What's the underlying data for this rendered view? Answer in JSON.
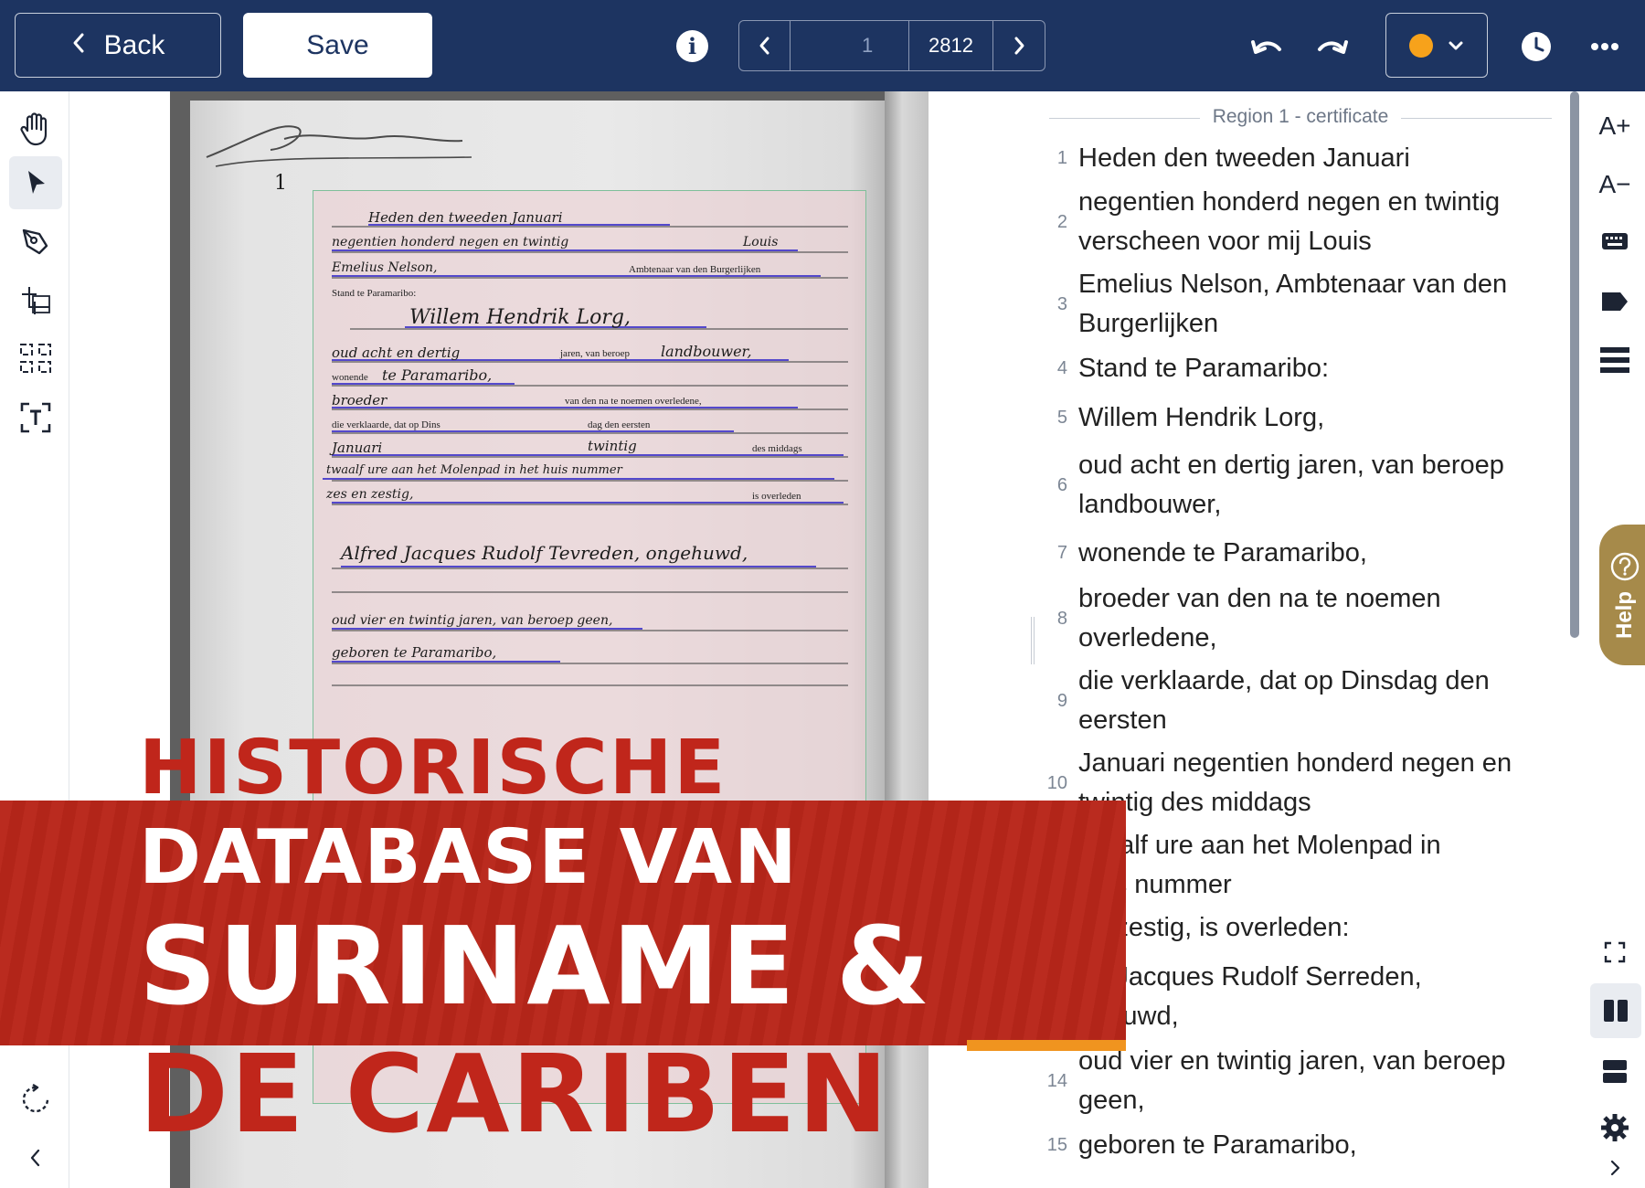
{
  "toolbar": {
    "back_label": "Back",
    "save_label": "Save",
    "info_label": "i",
    "pager": {
      "current_placeholder": "1",
      "total": "2812"
    },
    "status_color": "#f7a21b"
  },
  "left_tools": [
    "hand-icon",
    "pointer-icon",
    "pen-icon",
    "add-line-icon",
    "split-region-icon",
    "text-detect-icon",
    "rotate-icon",
    "collapse-left-icon"
  ],
  "transcript": {
    "region_title": "Region 1 - certificate",
    "lines": [
      {
        "num": "1",
        "text": "Heden den tweeden Januari"
      },
      {
        "num": "2",
        "text": "negentien honderd negen en twintig\nverscheen voor mij Louis"
      },
      {
        "num": "3",
        "text": "Emelius Nelson, Ambtenaar van den\nBurgerlijken"
      },
      {
        "num": "4",
        "text": "Stand te Paramaribo:"
      },
      {
        "num": "5",
        "text": "Willem Hendrik Lorg,"
      },
      {
        "num": "6",
        "text": "oud acht en dertig jaren, van beroep\nlandbouwer,"
      },
      {
        "num": "7",
        "text": "wonende te Paramaribo,"
      },
      {
        "num": "8",
        "text": "broeder van den na te noemen\noverledene,"
      },
      {
        "num": "9",
        "text": "die verklaarde, dat op Dinsdag den\neersten"
      },
      {
        "num": "10",
        "text": "Januari negentien honderd negen en\ntwintig des middags"
      },
      {
        "num": "",
        "text": "twaalf ure aan het Molenpad in\nhuis nummer"
      },
      {
        "num": "",
        "text": "en zestig, is overleden:"
      },
      {
        "num": "",
        "text": "ed Jacques Rudolf Serreden,\ngehuwd,"
      },
      {
        "num": "14",
        "text": "oud vier en twintig jaren, van beroep\ngeen,"
      },
      {
        "num": "15",
        "text": "geboren te Paramaribo,"
      }
    ]
  },
  "right_tools": {
    "font_increase": "A+",
    "font_decrease": "A−"
  },
  "help_label": "Help",
  "document": {
    "handwriting": [
      "Heden den tweeden Januari",
      "negentien honderd negen en twintig",
      "Louis",
      "Emelius Nelson,",
      "Ambtenaar van den Burgerlijken",
      "Stand te Paramaribo:",
      "Willem Hendrik Lorg,",
      "oud acht en dertig",
      "jaren, van beroep",
      "landbouwer,",
      "wonende",
      "te Paramaribo,",
      "broeder",
      "van den na te noemen overledene,",
      "die verklaarde, dat op Dins",
      "dag den eersten",
      "Januari",
      "twintig",
      "des middags",
      "twaalf ure aan het Molenpad in het huis nummer",
      "zes en zestig,",
      "is overleden",
      "Alfred Jacques Rudolf Tevreden, ongehuwd,",
      "oud vier en twintig jaren, van beroep geen,",
      "geboren te Paramaribo,"
    ]
  },
  "overlay": {
    "line1": "HISTORISCHE",
    "line2": "DATABASE VAN",
    "line3": "SURINAME &",
    "line4": "DE CARIBEN"
  }
}
